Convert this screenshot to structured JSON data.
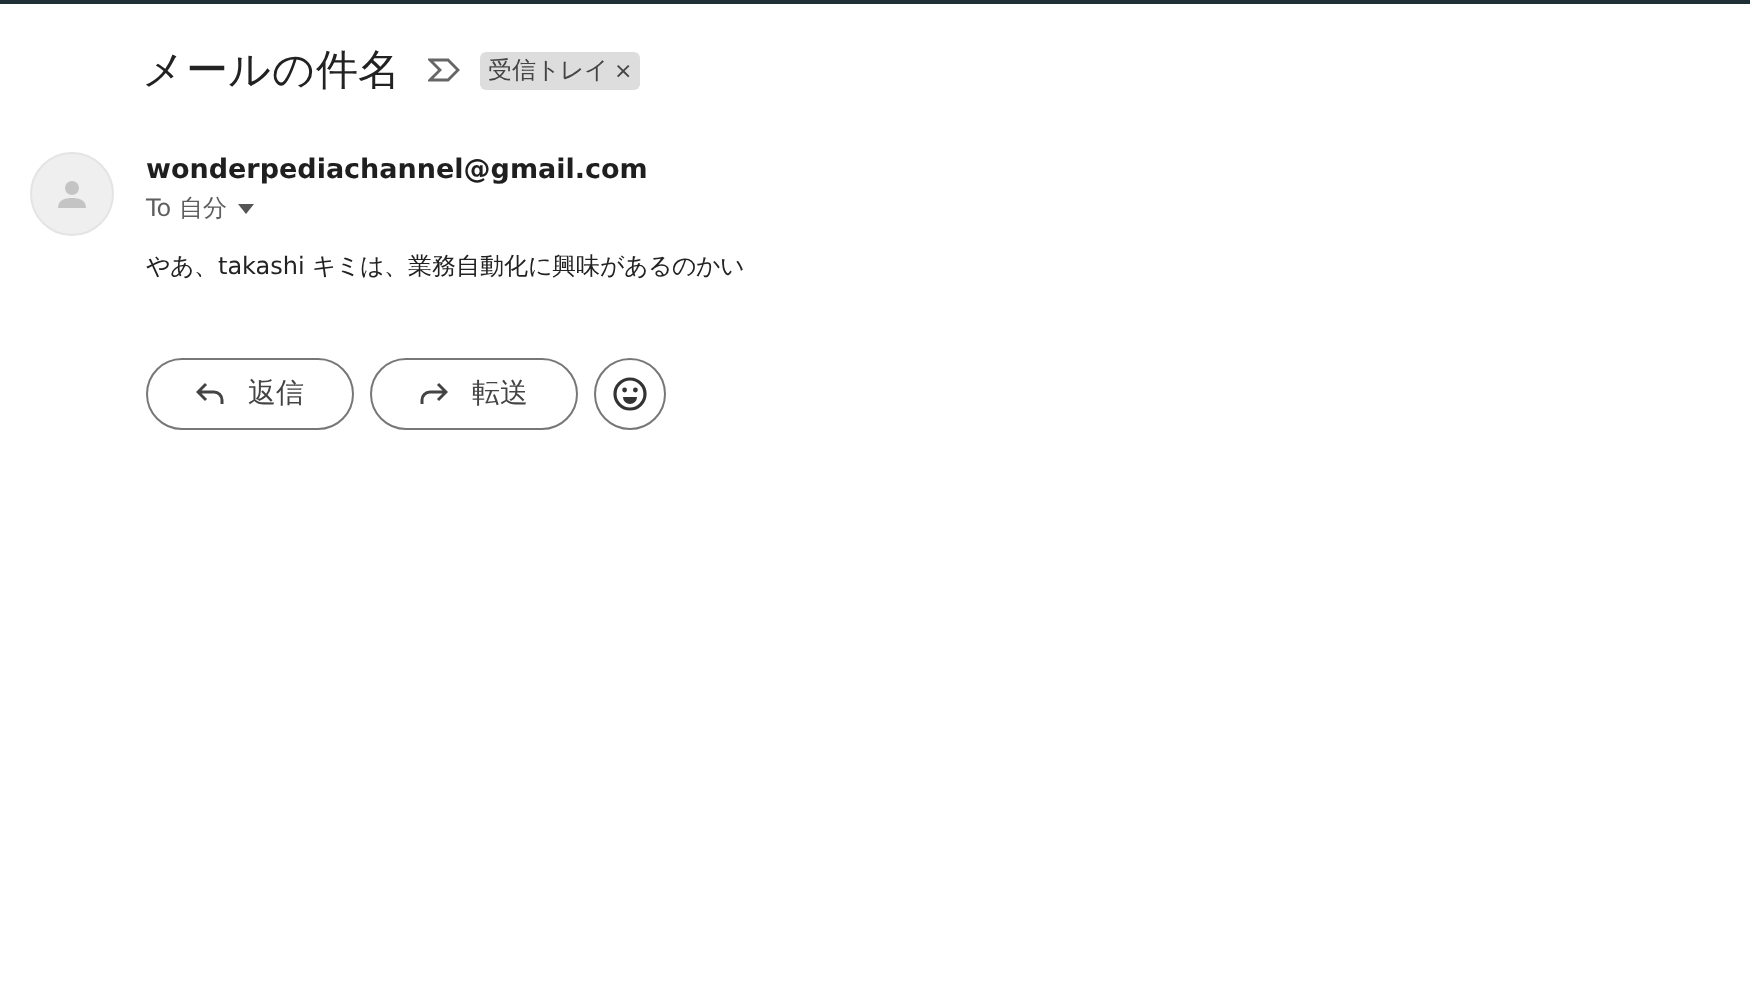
{
  "subject": "メールの件名",
  "label": {
    "text": "受信トレイ",
    "close": "×"
  },
  "sender": {
    "email": "wonderpediachannel@gmail.com",
    "to": "To 自分"
  },
  "body": "やあ、takashi キミは、業務自動化に興味があるのかい",
  "actions": [
    {
      "kind": "reply",
      "label": "返信"
    },
    {
      "kind": "forward",
      "label": "転送"
    }
  ]
}
